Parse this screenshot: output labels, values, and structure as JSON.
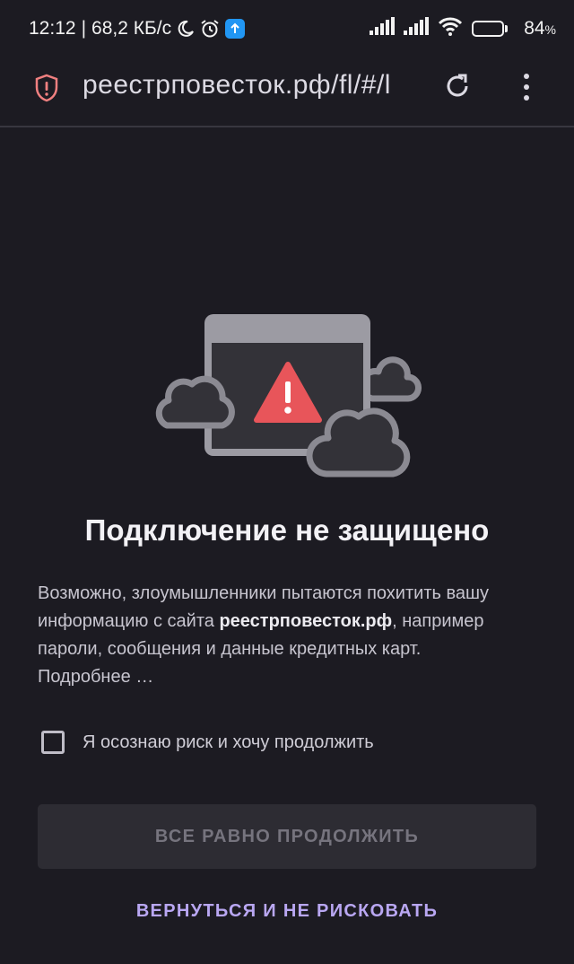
{
  "status_bar": {
    "time": "12:12",
    "network_speed": "68,2 КБ/с",
    "battery_percent": "84",
    "battery_percent_sign": "%",
    "battery_level": 0.84,
    "icons": [
      "moon-icon",
      "alarm-icon",
      "upload-icon",
      "signal-icon",
      "signal-icon",
      "wifi-icon",
      "battery-icon"
    ]
  },
  "browser": {
    "url": "реестрповесток.рф/fl/#/l",
    "icons": [
      "shield-warning-icon",
      "reload-icon",
      "more-vert-icon"
    ]
  },
  "error_page": {
    "title": "Подключение не защищено",
    "description_prefix": "Возможно, злоумышленники пытаются похитить вашу информацию с сайта ",
    "site": "реестрповесток.рф",
    "description_suffix": ", например пароли, сообщения и данные кредитных карт.",
    "more_link": "Подробнее …",
    "risk_checkbox_label": "Я осознаю риск и хочу продолжить",
    "risk_checkbox_checked": false,
    "continue_button": "ВСЕ РАВНО ПРОДОЛЖИТЬ",
    "back_button": "ВЕРНУТЬСЯ И НЕ РИСКОВАТЬ"
  },
  "colors": {
    "background": "#1c1b22",
    "warning_red": "#e8555a",
    "link_purple": "#b9a7f2",
    "battery_orange": "#f0a30a",
    "shield_red": "#f08080"
  }
}
